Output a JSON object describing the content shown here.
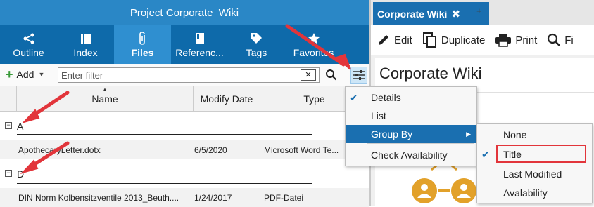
{
  "left_panel": {
    "title": "Project Corporate_Wiki",
    "nav_tabs": [
      {
        "label": "Outline",
        "icon": "share-icon"
      },
      {
        "label": "Index",
        "icon": "index-icon"
      },
      {
        "label": "Files",
        "icon": "paperclip-icon"
      },
      {
        "label": "Referenc...",
        "icon": "book-icon"
      },
      {
        "label": "Tags",
        "icon": "tag-icon"
      },
      {
        "label": "Favorites",
        "icon": "star-icon"
      }
    ],
    "toolbar": {
      "add_label": "Add",
      "filter_placeholder": "Enter filter",
      "clear_label": "✕"
    },
    "columns": [
      "Name",
      "Modify Date",
      "Type"
    ],
    "groups": [
      {
        "label": "A",
        "toggle": "−",
        "rows": [
          {
            "name": "ApothecaryLetter.dotx",
            "date": "6/5/2020",
            "type": "Microsoft Word Te..."
          }
        ]
      },
      {
        "label": "D",
        "toggle": "−",
        "rows": [
          {
            "name": "DIN Norm Kolbensitzventile 2013_Beuth....",
            "date": "1/24/2017",
            "type": "PDF-Datei"
          }
        ]
      }
    ]
  },
  "right_panel": {
    "tab_title": "Corporate Wiki",
    "tab_close": "✖",
    "new_tab": "+",
    "toolbar": [
      "Edit",
      "Duplicate",
      "Print",
      "Fi"
    ],
    "doc_title": "Corporate Wiki"
  },
  "context_menu": {
    "items": [
      {
        "label": "Details",
        "checked": "✔"
      },
      {
        "label": "List",
        "checked": ""
      },
      {
        "label": "Group By",
        "checked": "",
        "submenu_arrow": "▶"
      },
      {
        "label": "Check Availability",
        "checked": ""
      }
    ]
  },
  "submenu": {
    "items": [
      {
        "label": "None",
        "checked": ""
      },
      {
        "label": "Title",
        "checked": "✔"
      },
      {
        "label": "Last Modified",
        "checked": ""
      },
      {
        "label": "Avalability",
        "checked": ""
      }
    ]
  },
  "colors": {
    "title_bar": "#2a87c6",
    "nav_bar": "#0e6aaa",
    "nav_active": "#2f8fd0",
    "menu_highlight": "#1a6fb0",
    "annotation_red": "#e2353b"
  }
}
